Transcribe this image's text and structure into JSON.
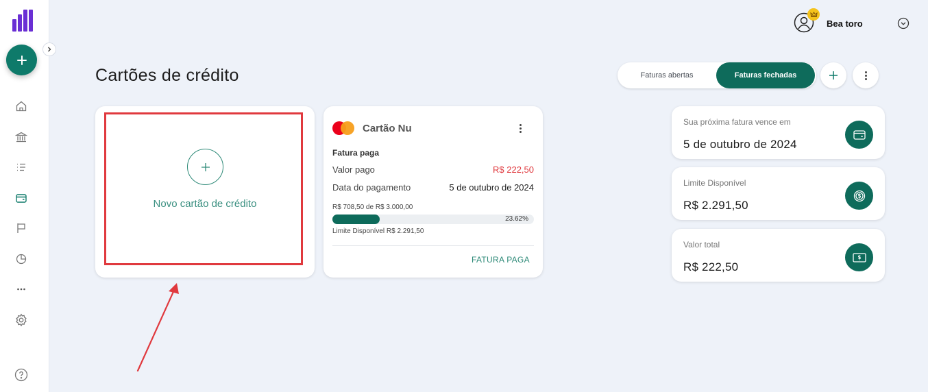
{
  "user": {
    "name": "Bea toro"
  },
  "page": {
    "title": "Cartões de crédito"
  },
  "toggle": {
    "open_label": "Faturas abertas",
    "closed_label": "Faturas fechadas",
    "active": "closed"
  },
  "new_card": {
    "label": "Novo cartão de crédito"
  },
  "credit_card": {
    "name": "Cartão Nu",
    "brand": "mastercard",
    "status_title": "Fatura paga",
    "paid_label": "Valor pago",
    "paid_value": "R$ 222,50",
    "date_label": "Data do pagamento",
    "date_value": "5 de outubro de 2024",
    "usage_text": "R$ 708,50 de R$ 3.000,00",
    "usage_percent": 23.62,
    "usage_percent_label": "23.62%",
    "limit_text": "Limite Disponível R$ 2.291,50",
    "action_label": "FATURA PAGA"
  },
  "summary": [
    {
      "label": "Sua próxima fatura vence em",
      "value": "5 de outubro de 2024",
      "icon": "card-icon"
    },
    {
      "label": "Limite Disponível",
      "value": "R$ 2.291,50",
      "icon": "coin-icon"
    },
    {
      "label": "Valor total",
      "value": "R$ 222,50",
      "icon": "money-icon"
    }
  ],
  "sidebar": {
    "items": [
      "home-icon",
      "bank-icon",
      "list-icon",
      "wallet-icon",
      "flag-icon",
      "pie-chart-icon",
      "more-icon",
      "gear-icon"
    ],
    "active": "wallet-icon"
  },
  "colors": {
    "primary": "#0e6b5b",
    "accent": "#0e7a6a",
    "logo": "#6a2fd4",
    "highlight": "#e0393e",
    "negative": "#e0393e"
  }
}
